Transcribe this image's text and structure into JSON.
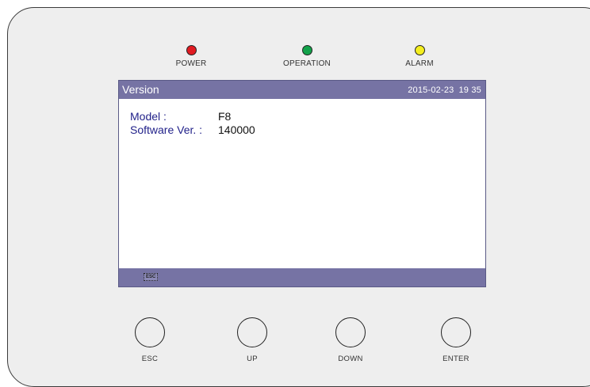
{
  "indicators": [
    {
      "label": "POWER",
      "color": "#e11b22"
    },
    {
      "label": "OPERATION",
      "color": "#12a24a"
    },
    {
      "label": "ALARM",
      "color": "#f4ee1e"
    }
  ],
  "screen": {
    "title": "Version",
    "date": "2015-02-23",
    "time": "19 35",
    "rows": [
      {
        "key": "Model :",
        "value": "F8"
      },
      {
        "key": "Software Ver. :",
        "value": "140000"
      }
    ],
    "footer_key": "ESC"
  },
  "buttons": [
    {
      "label": "ESC"
    },
    {
      "label": "UP"
    },
    {
      "label": "DOWN"
    },
    {
      "label": "ENTER"
    }
  ]
}
